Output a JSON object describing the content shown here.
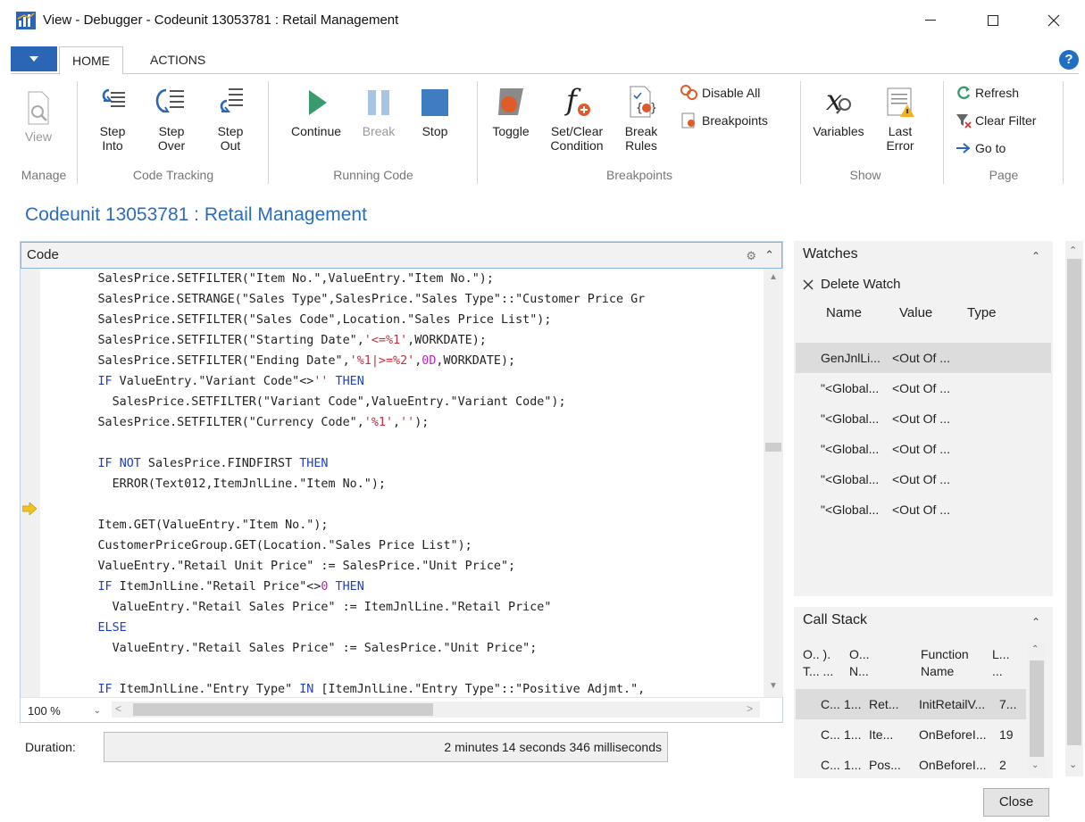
{
  "window": {
    "title": "View - Debugger - Codeunit 13053781 : Retail Management"
  },
  "ribbon": {
    "tabs": [
      "HOME",
      "ACTIONS"
    ],
    "groups": {
      "manage": "Manage",
      "code_tracking": "Code Tracking",
      "running_code": "Running Code",
      "breakpoints": "Breakpoints",
      "show": "Show",
      "page": "Page"
    },
    "buttons": {
      "view": "View",
      "step_into_1": "Step",
      "step_into_2": "Into",
      "step_over_1": "Step",
      "step_over_2": "Over",
      "step_out_1": "Step",
      "step_out_2": "Out",
      "continue": "Continue",
      "break": "Break",
      "stop": "Stop",
      "toggle": "Toggle",
      "set_clear_1": "Set/Clear",
      "set_clear_2": "Condition",
      "break_rules_1": "Break",
      "break_rules_2": "Rules",
      "disable_all": "Disable All",
      "breakpoints": "Breakpoints",
      "variables": "Variables",
      "last_error_1": "Last",
      "last_error_2": "Error",
      "refresh": "Refresh",
      "clear_filter": "Clear Filter",
      "go_to": "Go to"
    },
    "colors": {
      "accent": "#2a66b5",
      "run_green": "#3a9a6e",
      "stop_blue": "#3f7cc1"
    }
  },
  "page": {
    "title": "Codeunit 13053781 : Retail Management"
  },
  "code_panel": {
    "label": "Code",
    "lines": [
      "        SalesPrice.SETFILTER(\"Item No.\",ValueEntry.\"Item No.\");",
      "        SalesPrice.SETRANGE(\"Sales Type\",SalesPrice.\"Sales Type\"::\"Customer Price Gr",
      "        SalesPrice.SETFILTER(\"Sales Code\",Location.\"Sales Price List\");",
      "        SalesPrice.SETFILTER(\"Starting Date\",'<=%1',WORKDATE);",
      "        SalesPrice.SETFILTER(\"Ending Date\",'%1|>=%2',0D,WORKDATE);",
      "        IF ValueEntry.\"Variant Code\"<>'' THEN",
      "          SalesPrice.SETFILTER(\"Variant Code\",ValueEntry.\"Variant Code\");",
      "        SalesPrice.SETFILTER(\"Currency Code\",'%1','');",
      "",
      "        IF NOT SalesPrice.FINDFIRST THEN",
      "          ERROR(Text012,ItemJnlLine.\"Item No.\");",
      "",
      "        Item.GET(ValueEntry.\"Item No.\");",
      "        CustomerPriceGroup.GET(Location.\"Sales Price List\");",
      "        ValueEntry.\"Retail Unit Price\" := SalesPrice.\"Unit Price\";",
      "        IF ItemJnlLine.\"Retail Price\"<>0 THEN",
      "          ValueEntry.\"Retail Sales Price\" := ItemJnlLine.\"Retail Price\"",
      "        ELSE",
      "          ValueEntry.\"Retail Sales Price\" := SalesPrice.\"Unit Price\";",
      "",
      "        IF ItemJnlLine.\"Entry Type\" IN [ItemJnlLine.\"Entry Type\"::\"Positive Adjmt.\","
    ],
    "current_line_index": 10,
    "zoom": "100 %"
  },
  "duration": {
    "label": "Duration:",
    "value": "2 minutes 14 seconds 346 milliseconds"
  },
  "watches": {
    "title": "Watches",
    "delete_label": "Delete Watch",
    "columns": [
      "Name",
      "Value",
      "Type"
    ],
    "rows": [
      {
        "name": "GenJnlLi...",
        "value": "<Out Of ..."
      },
      {
        "name": "\"<Global...",
        "value": "<Out Of ..."
      },
      {
        "name": "\"<Global...",
        "value": "<Out Of ..."
      },
      {
        "name": "\"<Global...",
        "value": "<Out Of ..."
      },
      {
        "name": "\"<Global...",
        "value": "<Out Of ..."
      },
      {
        "name": "\"<Global...",
        "value": "<Out Of ..."
      }
    ]
  },
  "call_stack": {
    "title": "Call Stack",
    "columns": [
      {
        "l1": "O.. ).",
        "l2": "T... ..."
      },
      {
        "l1": "O...",
        "l2": "N..."
      },
      {
        "l1": "Function",
        "l2": "Name"
      },
      {
        "l1": "L...",
        "l2": "..."
      }
    ],
    "rows": [
      {
        "c1": "C...",
        "c2": "1...",
        "c3": "Ret...",
        "c4": "InitRetailV...",
        "c5": "7..."
      },
      {
        "c1": "C...",
        "c2": "1...",
        "c3": "Ite...",
        "c4": "OnBeforeI...",
        "c5": "19"
      },
      {
        "c1": "C...",
        "c2": "1...",
        "c3": "Pos...",
        "c4": "OnBeforeI...",
        "c5": "2"
      }
    ]
  },
  "footer": {
    "close_label": "Close"
  }
}
